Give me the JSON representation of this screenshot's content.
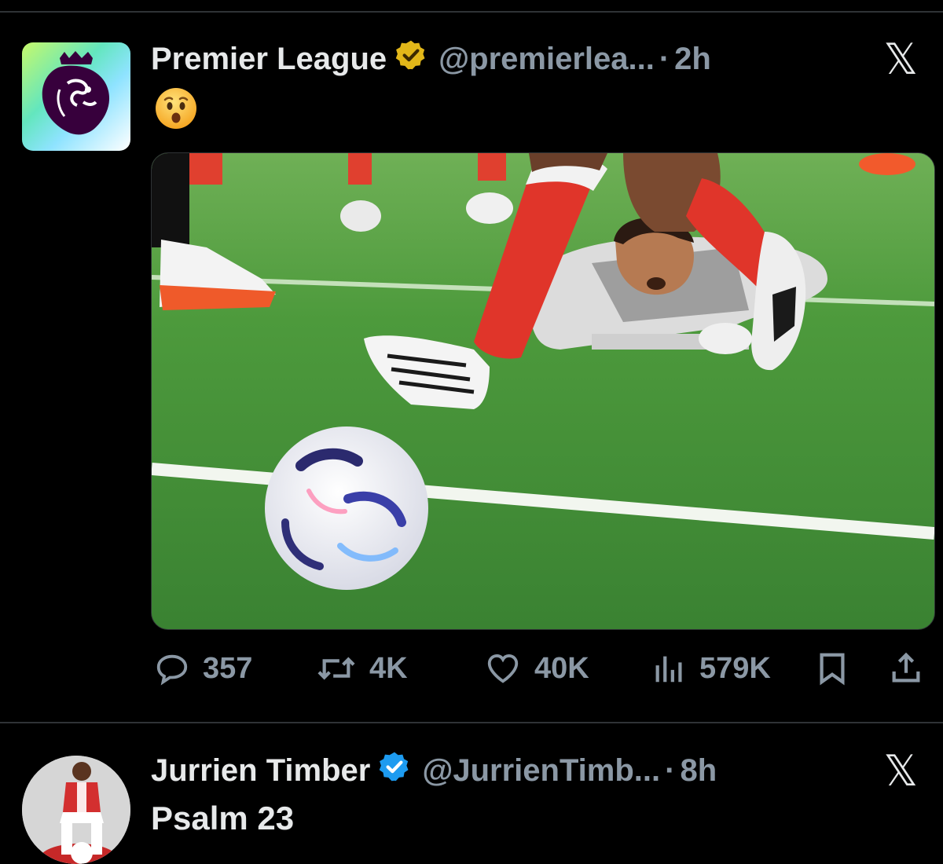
{
  "tweets": [
    {
      "author_name": "Premier League",
      "handle": "@premierlea...",
      "separator": "·",
      "time": "2h",
      "verified": "gold",
      "text_emoji": "hushed-face-emoji",
      "image_alt": "Goalkeeper lying on the pitch watching the ball",
      "stats": {
        "replies": "357",
        "reposts": "4K",
        "likes": "40K",
        "views": "579K"
      }
    },
    {
      "author_name": "Jurrien Timber",
      "handle": "@JurrienTimb...",
      "separator": "·",
      "time": "8h",
      "verified": "blue",
      "text": "Psalm 23"
    }
  ],
  "icons": {
    "reply": "speech-bubble-icon",
    "repost": "repost-icon",
    "like": "heart-icon",
    "views": "bar-chart-icon",
    "bookmark": "bookmark-icon",
    "share": "share-icon",
    "x_logo": "x-logo-icon"
  },
  "colors": {
    "background": "#000000",
    "text_primary": "#e7e9ea",
    "text_secondary": "#8b98a5",
    "verified_gold": "#e2b719",
    "verified_blue": "#1d9bf0",
    "pl_purple": "#37003c"
  }
}
